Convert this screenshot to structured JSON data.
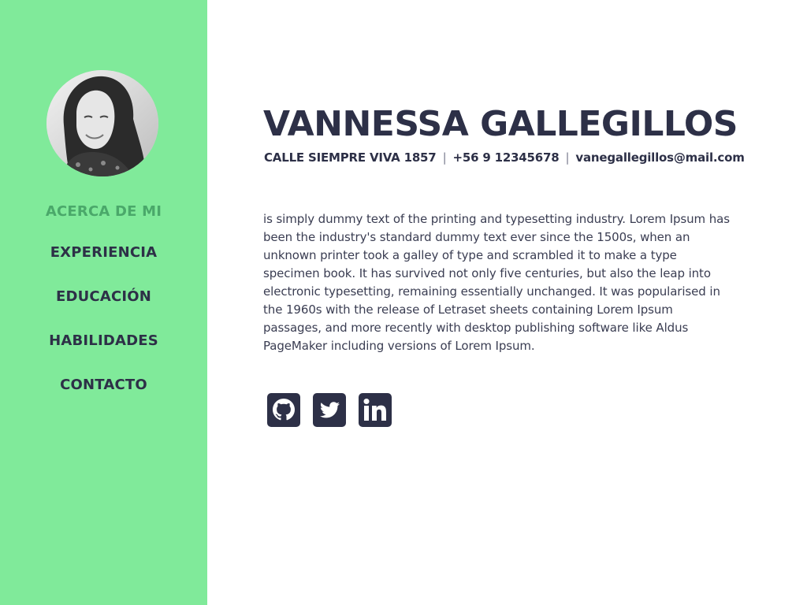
{
  "profile": {
    "name": "VANNESSA GALLEGILLOS",
    "address": "CALLE SIEMPRE VIVA 1857",
    "phone": "+56 9 12345678",
    "email": "vanegallegillos@mail.com",
    "separator": "|",
    "about": "is simply dummy text of the printing and typesetting industry. Lorem Ipsum has been the industry's standard dummy text ever since the 1500s, when an unknown printer took a galley of type and scrambled it to make a type specimen book. It has survived not only five centuries, but also the leap into electronic typesetting, remaining essentially unchanged. It was popularised in the 1960s with the release of Letraset sheets containing Lorem Ipsum passages, and more recently with desktop publishing software like Aldus PageMaker including versions of Lorem Ipsum."
  },
  "nav": {
    "items": [
      {
        "label": "ACERCA DE MI",
        "active": true
      },
      {
        "label": "EXPERIENCIA",
        "active": false
      },
      {
        "label": "EDUCACIÓN",
        "active": false
      },
      {
        "label": "HABILIDADES",
        "active": false
      },
      {
        "label": "CONTACTO",
        "active": false
      }
    ]
  },
  "social": {
    "icons": [
      "github-icon",
      "twitter-icon",
      "linkedin-icon"
    ]
  },
  "colors": {
    "sidebar": "#80ea9a",
    "text_dark": "#2d3047",
    "nav_active": "#4aa86a",
    "icon": "#2d3047"
  }
}
